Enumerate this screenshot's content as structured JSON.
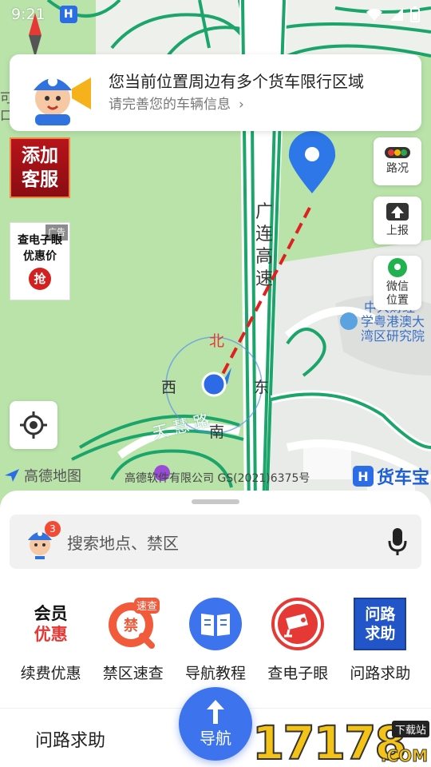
{
  "status_bar": {
    "time": "9:21"
  },
  "notice": {
    "title": "您当前位置周边有多个货车限行区域",
    "subtitle": "请完善您的车辆信息"
  },
  "promos": {
    "kefu": [
      "添加",
      "客服"
    ],
    "eye": {
      "line1": "查电子眼",
      "line2": "优惠价",
      "button": "抢",
      "ad_tag": "广告"
    }
  },
  "map_buttons": {
    "traffic": "路况",
    "report": "上报",
    "wechat": [
      "微信",
      "位置"
    ]
  },
  "map_labels": {
    "expressway": [
      "广",
      "连",
      "高",
      "速"
    ],
    "road": "天 慧 路",
    "institute": [
      "中大财经",
      "学粤港澳大",
      "湾区研究院"
    ]
  },
  "compass": {
    "north": "北",
    "south": "南",
    "east": "东",
    "west": "西"
  },
  "copyright": {
    "amap": "高德地图",
    "gs": "高德软件有限公司 GS(2021)6375号",
    "brand": "货车宝"
  },
  "search": {
    "badge_count": "3",
    "placeholder": "搜索地点、禁区"
  },
  "grid": [
    {
      "type": "vip",
      "line1": "会员",
      "line2": "优惠",
      "label": "续费优惠"
    },
    {
      "type": "ban",
      "tag": "速查",
      "glyph": "禁",
      "label": "禁区速查"
    },
    {
      "type": "tutorial",
      "label": "导航教程"
    },
    {
      "type": "camera",
      "label": "查电子眼"
    },
    {
      "type": "help",
      "line1": "问路",
      "line2": "求助",
      "label": "问路求助"
    }
  ],
  "bottom_bar": {
    "ask": "问路求助",
    "navigate": "导航"
  },
  "watermark": {
    "number": "17178",
    "tag": "下载站",
    "suffix": ".COM"
  },
  "colors": {
    "accent": "#3d74ee",
    "map_green": "#b9e3a9",
    "road_green": "#1ba56a",
    "danger": "#e53935"
  }
}
